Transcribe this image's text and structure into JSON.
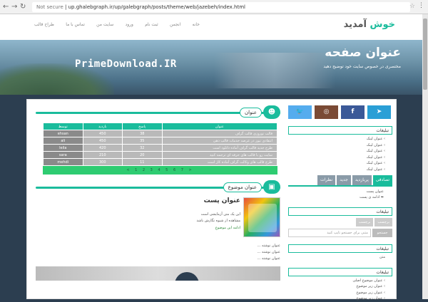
{
  "browser": {
    "url_prefix": "Not secure",
    "url": "up.ghalebgraph.ir/up/galebgraph/posts/theme/web/jazebeh/index.html"
  },
  "header": {
    "logo_accent": "خوش",
    "logo_rest": "آمدید",
    "nav": [
      "خانه",
      "انجمن",
      "ثبت نام",
      "ورود",
      "سایت من",
      "تماس با ما",
      "طراح قالب"
    ]
  },
  "hero": {
    "title": "عنوان صفحه",
    "description": "مختصری در خصوص سایت خود توضیح دهید",
    "watermark": "PrimeDownload.IR"
  },
  "main": {
    "section1_label": "عنوان",
    "table": {
      "headers": [
        "عنوان",
        "پاسخ",
        "بازدید",
        "توسط"
      ],
      "rows": [
        [
          "قالب نوروزی قالب گراف",
          "38",
          "450",
          "ehsan"
        ],
        [
          "انتقادی نیوز در عرصه خدمات قالب دهی",
          "35",
          "450",
          "ali"
        ],
        [
          "طرح جدید قالب گراف آماده دانلود است",
          "32",
          "420",
          "leila"
        ],
        [
          "سایت رو با قالب های حرفه ای ترجمه کنید",
          "20",
          "210",
          "sara"
        ],
        [
          "طرح قالب های وکالت گراف آماده کار است",
          "11",
          "300",
          "mehdi"
        ]
      ],
      "pager": "< 1 2 3 4 5 6 7 >"
    },
    "section2_label": "عنوان موضوع",
    "post": {
      "title": "عنوان پست",
      "desc": "این یک متن آزمایشی است",
      "desc2": "مشاهده از شیوه نگارش باشد",
      "more": "ادامه این موضوع",
      "list": [
        "عنوان نوشته ...",
        "عنوان نوشته ...",
        "عنوان نوشته ..."
      ]
    }
  },
  "sidebar": {
    "box1_title": "تبلیغات",
    "box1_items": [
      "عنوان لینک",
      "عنوان لینک",
      "عنوان لینک",
      "عنوان لینک",
      "عنوان لینک",
      "عنوان لینک"
    ],
    "tabs": [
      "تصادفی",
      "پربازدید",
      "جدید",
      "نظرات"
    ],
    "tab_items": [
      "عنوان پست",
      "ادامه ی پست"
    ],
    "box2_title": "تبلیغات",
    "tags": [
      "برچسب",
      "برچسب"
    ],
    "search_button": "جستجو",
    "search_placeholder": "متنی برای جستجو تایپ کنید",
    "box3_title": "تبلیغات",
    "box3_text": "متن",
    "box4_title": "تبلیغات",
    "box4_items": [
      "عنوان موضوع اصلی",
      "عنوان زیر موضوع",
      "عنوان زیر موضوع",
      "عنوان زیر موضوع"
    ]
  }
}
